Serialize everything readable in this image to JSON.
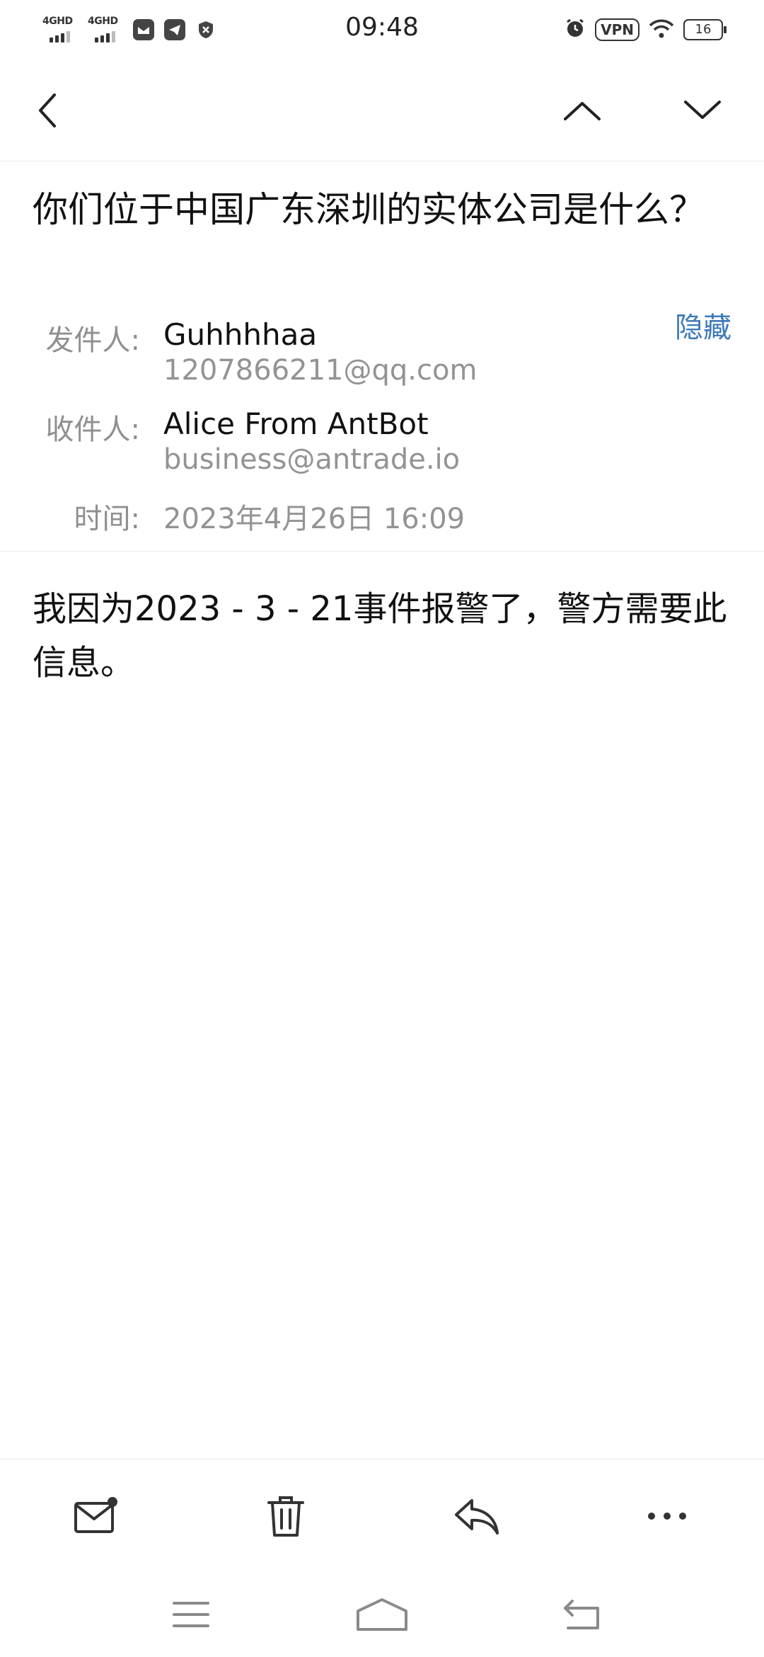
{
  "status_bar": {
    "time": "09:48",
    "signal1_label": "4GHD",
    "signal2_label": "4GHD",
    "vpn": "VPN",
    "battery": "16"
  },
  "nav": {
    "icons": [
      "back-icon",
      "chevron-up-icon",
      "chevron-down-icon"
    ]
  },
  "email": {
    "subject": "你们位于中国广东深圳的实体公司是什么？",
    "hide_label": "隐藏",
    "from_label": "发件人:",
    "from_name": "Guhhhhaa",
    "from_email": "1207866211@qq.com",
    "to_label": "收件人:",
    "to_name": "Alice From AntBot",
    "to_email": "business@antrade.io",
    "time_label": "时间:",
    "time_value": "2023年4月26日 16:09",
    "body": "我因为2023 - 3 - 21事件报警了，警方需要此信息。"
  },
  "toolbar": {
    "icons": [
      "mark-unread-icon",
      "trash-icon",
      "reply-icon",
      "more-icon"
    ]
  },
  "system_nav": {
    "icons": [
      "menu-icon",
      "home-icon",
      "back-nav-icon"
    ]
  },
  "colors": {
    "accent": "#3d7ab8",
    "label_gray": "#8f8f8f",
    "text": "#111111",
    "divider": "#ececec"
  }
}
